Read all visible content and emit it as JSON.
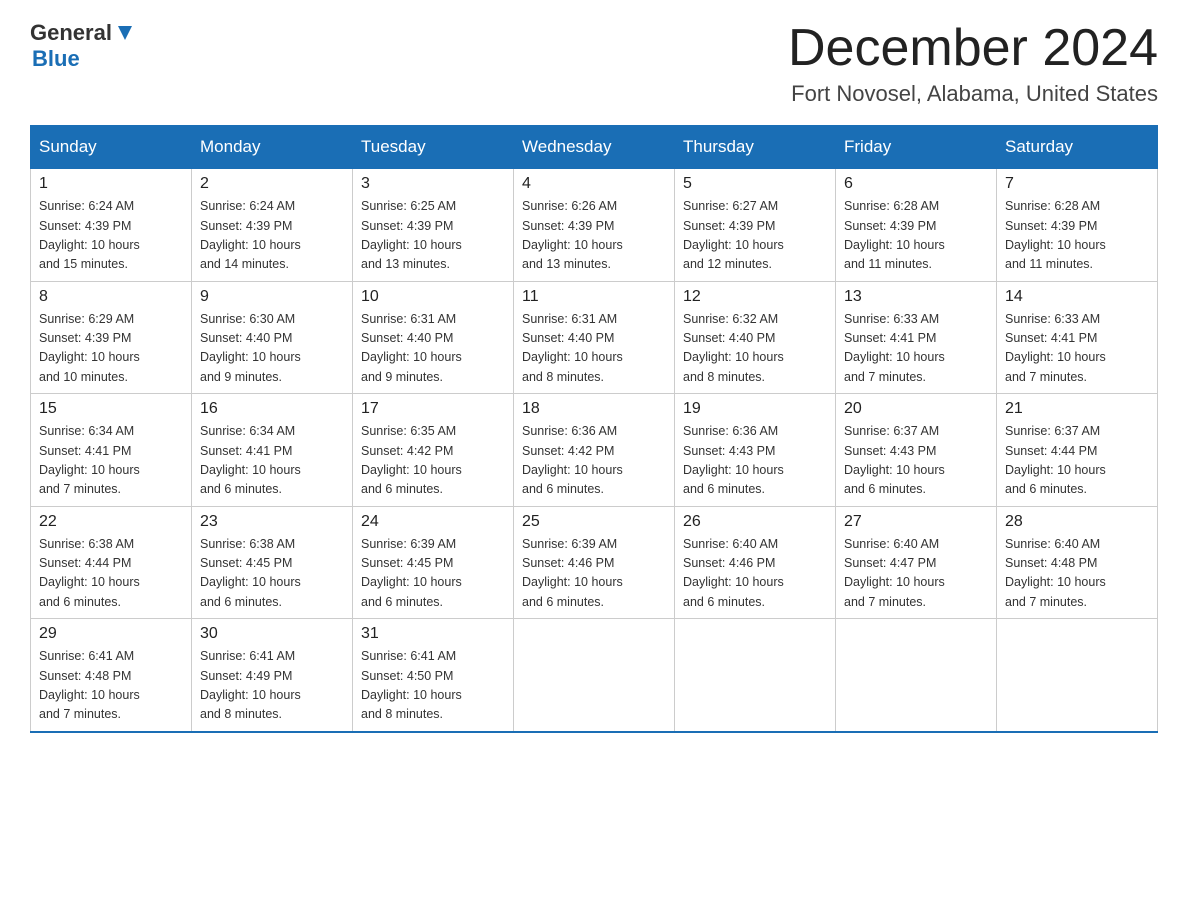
{
  "header": {
    "logo_general": "General",
    "logo_blue": "Blue",
    "month_year": "December 2024",
    "location": "Fort Novosel, Alabama, United States"
  },
  "weekdays": [
    "Sunday",
    "Monday",
    "Tuesday",
    "Wednesday",
    "Thursday",
    "Friday",
    "Saturday"
  ],
  "weeks": [
    [
      {
        "day": "1",
        "sunrise": "6:24 AM",
        "sunset": "4:39 PM",
        "daylight": "10 hours and 15 minutes."
      },
      {
        "day": "2",
        "sunrise": "6:24 AM",
        "sunset": "4:39 PM",
        "daylight": "10 hours and 14 minutes."
      },
      {
        "day": "3",
        "sunrise": "6:25 AM",
        "sunset": "4:39 PM",
        "daylight": "10 hours and 13 minutes."
      },
      {
        "day": "4",
        "sunrise": "6:26 AM",
        "sunset": "4:39 PM",
        "daylight": "10 hours and 13 minutes."
      },
      {
        "day": "5",
        "sunrise": "6:27 AM",
        "sunset": "4:39 PM",
        "daylight": "10 hours and 12 minutes."
      },
      {
        "day": "6",
        "sunrise": "6:28 AM",
        "sunset": "4:39 PM",
        "daylight": "10 hours and 11 minutes."
      },
      {
        "day": "7",
        "sunrise": "6:28 AM",
        "sunset": "4:39 PM",
        "daylight": "10 hours and 11 minutes."
      }
    ],
    [
      {
        "day": "8",
        "sunrise": "6:29 AM",
        "sunset": "4:39 PM",
        "daylight": "10 hours and 10 minutes."
      },
      {
        "day": "9",
        "sunrise": "6:30 AM",
        "sunset": "4:40 PM",
        "daylight": "10 hours and 9 minutes."
      },
      {
        "day": "10",
        "sunrise": "6:31 AM",
        "sunset": "4:40 PM",
        "daylight": "10 hours and 9 minutes."
      },
      {
        "day": "11",
        "sunrise": "6:31 AM",
        "sunset": "4:40 PM",
        "daylight": "10 hours and 8 minutes."
      },
      {
        "day": "12",
        "sunrise": "6:32 AM",
        "sunset": "4:40 PM",
        "daylight": "10 hours and 8 minutes."
      },
      {
        "day": "13",
        "sunrise": "6:33 AM",
        "sunset": "4:41 PM",
        "daylight": "10 hours and 7 minutes."
      },
      {
        "day": "14",
        "sunrise": "6:33 AM",
        "sunset": "4:41 PM",
        "daylight": "10 hours and 7 minutes."
      }
    ],
    [
      {
        "day": "15",
        "sunrise": "6:34 AM",
        "sunset": "4:41 PM",
        "daylight": "10 hours and 7 minutes."
      },
      {
        "day": "16",
        "sunrise": "6:34 AM",
        "sunset": "4:41 PM",
        "daylight": "10 hours and 6 minutes."
      },
      {
        "day": "17",
        "sunrise": "6:35 AM",
        "sunset": "4:42 PM",
        "daylight": "10 hours and 6 minutes."
      },
      {
        "day": "18",
        "sunrise": "6:36 AM",
        "sunset": "4:42 PM",
        "daylight": "10 hours and 6 minutes."
      },
      {
        "day": "19",
        "sunrise": "6:36 AM",
        "sunset": "4:43 PM",
        "daylight": "10 hours and 6 minutes."
      },
      {
        "day": "20",
        "sunrise": "6:37 AM",
        "sunset": "4:43 PM",
        "daylight": "10 hours and 6 minutes."
      },
      {
        "day": "21",
        "sunrise": "6:37 AM",
        "sunset": "4:44 PM",
        "daylight": "10 hours and 6 minutes."
      }
    ],
    [
      {
        "day": "22",
        "sunrise": "6:38 AM",
        "sunset": "4:44 PM",
        "daylight": "10 hours and 6 minutes."
      },
      {
        "day": "23",
        "sunrise": "6:38 AM",
        "sunset": "4:45 PM",
        "daylight": "10 hours and 6 minutes."
      },
      {
        "day": "24",
        "sunrise": "6:39 AM",
        "sunset": "4:45 PM",
        "daylight": "10 hours and 6 minutes."
      },
      {
        "day": "25",
        "sunrise": "6:39 AM",
        "sunset": "4:46 PM",
        "daylight": "10 hours and 6 minutes."
      },
      {
        "day": "26",
        "sunrise": "6:40 AM",
        "sunset": "4:46 PM",
        "daylight": "10 hours and 6 minutes."
      },
      {
        "day": "27",
        "sunrise": "6:40 AM",
        "sunset": "4:47 PM",
        "daylight": "10 hours and 7 minutes."
      },
      {
        "day": "28",
        "sunrise": "6:40 AM",
        "sunset": "4:48 PM",
        "daylight": "10 hours and 7 minutes."
      }
    ],
    [
      {
        "day": "29",
        "sunrise": "6:41 AM",
        "sunset": "4:48 PM",
        "daylight": "10 hours and 7 minutes."
      },
      {
        "day": "30",
        "sunrise": "6:41 AM",
        "sunset": "4:49 PM",
        "daylight": "10 hours and 8 minutes."
      },
      {
        "day": "31",
        "sunrise": "6:41 AM",
        "sunset": "4:50 PM",
        "daylight": "10 hours and 8 minutes."
      },
      null,
      null,
      null,
      null
    ]
  ],
  "labels": {
    "sunrise": "Sunrise:",
    "sunset": "Sunset:",
    "daylight": "Daylight:"
  }
}
